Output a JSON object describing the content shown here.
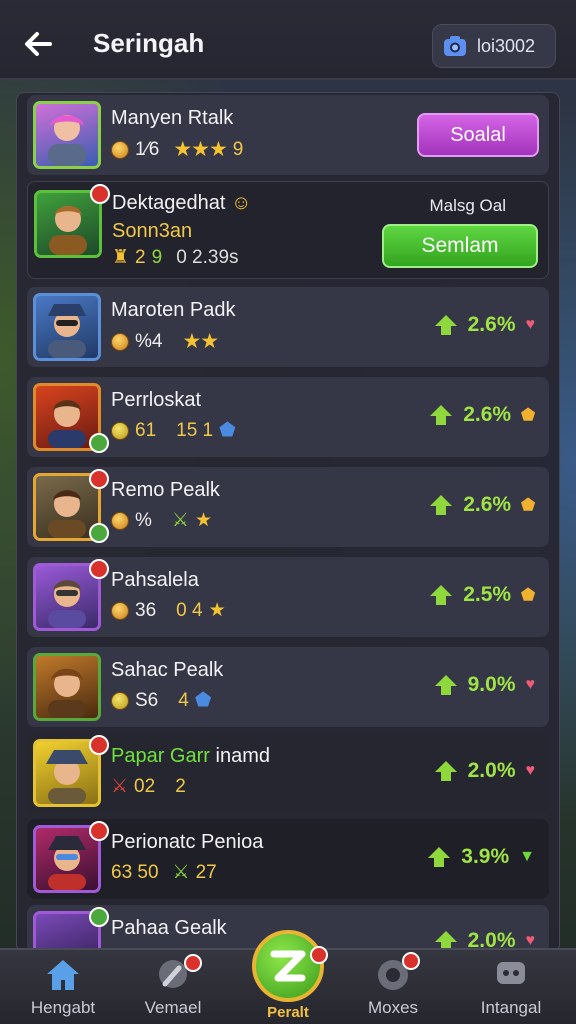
{
  "header": {
    "title": "Seringah",
    "uid": "loi3002"
  },
  "colors": {
    "accent_green": "#9fe344",
    "button_purple": "#c24fd7",
    "button_green": "#45c22f",
    "gold": "#e5a632"
  },
  "rows": [
    {
      "name": "Manyen Rtalk",
      "stat1": "1⁄6",
      "stars": "★★★",
      "stat2": "9",
      "action": "Soalal"
    },
    {
      "name": "Dektagedhat",
      "subname": "Sonn3an",
      "stat1": "2",
      "stat2": "9",
      "stat3": "0 2.39s",
      "caption": "Malsg Oal",
      "action": "Semlam"
    },
    {
      "name": "Maroten Padk",
      "stat1": "%4",
      "stars": "★★",
      "pct": "2.6%"
    },
    {
      "name": "Perrloskat",
      "stat1": "61",
      "stat2": "15 1",
      "pct": "2.6%"
    },
    {
      "name": "Remo Pealk",
      "stat1": "%",
      "stat2": "★",
      "pct": "2.6%"
    },
    {
      "name": "Pahsalela",
      "stat1": "36",
      "stat2": "0 4",
      "pct": "2.5%"
    },
    {
      "name": "Sahac Pealk",
      "stat1": "S6",
      "stat2": "4",
      "pct": "9.0%"
    },
    {
      "name_highlight": "Papar Garr",
      "name_rest": "inamd",
      "stat1": "02",
      "stat2": "2",
      "pct": "2.0%"
    },
    {
      "name": "Perionatc Penioa",
      "stat1": "63 50",
      "stat2": "27",
      "pct": "3.9%"
    },
    {
      "name": "Pahaa Gealk",
      "pct": "2.0%"
    }
  ],
  "tabs": [
    {
      "label": "Hengabt",
      "icon": "home-icon"
    },
    {
      "label": "Vemael",
      "icon": "wrench-icon"
    },
    {
      "label": "Peralt",
      "icon": "play-icon"
    },
    {
      "label": "Moxes",
      "icon": "gamepad-icon"
    },
    {
      "label": "Intangal",
      "icon": "chat-icon"
    }
  ]
}
